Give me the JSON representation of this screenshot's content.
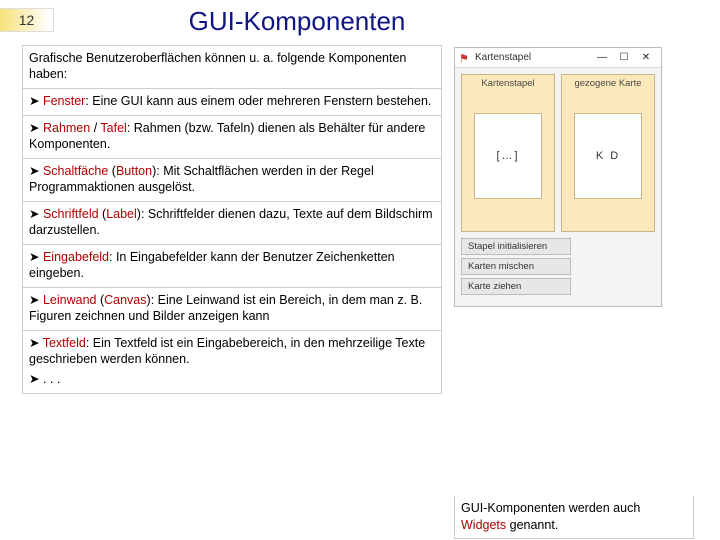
{
  "slide_number": "12",
  "title": "GUI-Komponenten",
  "intro": "Grafische Benutzeroberflächen können u. a. folgende Komponenten haben:",
  "items": [
    {
      "term": "Fenster",
      "aka": "",
      "desc": ": Eine GUI kann aus einem oder mehreren Fenstern bestehen."
    },
    {
      "term": "Rahmen",
      "aka": "Tafel",
      "desc": ": Rahmen (bzw. Tafeln) dienen als Behälter für andere Komponenten."
    },
    {
      "term": "Schaltfäche",
      "aka": "Button",
      "desc": ": Mit Schaltflächen werden in der Regel Programmaktionen ausgelöst."
    },
    {
      "term": "Schriftfeld",
      "aka": "Label",
      "desc": ": Schriftfelder dienen dazu, Texte auf dem Bildschirm darzustellen."
    },
    {
      "term": "Eingabefeld",
      "aka": "",
      "desc": ": In Eingabefelder kann der Benutzer Zeichenketten eingeben."
    },
    {
      "term": "Leinwand",
      "aka": "Canvas",
      "desc": ": Eine Leinwand ist ein Bereich, in dem man z. B. Figuren zeichnen und Bilder anzeigen kann"
    },
    {
      "term": "Textfeld",
      "aka": "",
      "desc": ": Ein Textfeld ist ein Eingabebereich, in den mehrzeilige Texte geschrieben werden können."
    }
  ],
  "ellipsis": "➤ . . .",
  "app": {
    "title": "Kartenstapel",
    "col1": "Kartenstapel",
    "col2": "gezogene Karte",
    "card1": "[…]",
    "card2": "K D",
    "btn1": "Stapel initialisieren",
    "btn2": "Karten mischen",
    "btn3": "Karte ziehen"
  },
  "caption_pre": "GUI-Komponenten werden auch ",
  "caption_term": "Widgets",
  "caption_post": " genannt.",
  "glyphs": {
    "arrow": "➤",
    "slash": " / ",
    "open": " (",
    "close": ")",
    "min": "—",
    "max": "☐",
    "close_x": "✕"
  }
}
